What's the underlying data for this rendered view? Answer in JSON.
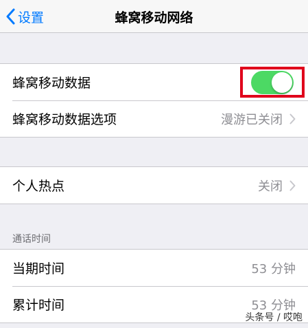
{
  "navbar": {
    "back_label": "设置",
    "title": "蜂窝移动网络"
  },
  "cellular_group": {
    "cellular_data_label": "蜂窝移动数据",
    "cellular_data_enabled": true,
    "cellular_options_label": "蜂窝移动数据选项",
    "cellular_options_value": "漫游已关闭"
  },
  "hotspot_group": {
    "label": "个人热点",
    "value": "关闭"
  },
  "call_time": {
    "header": "通话时间",
    "current_period_label": "当期时间",
    "current_period_value": "53 分钟",
    "lifetime_label": "累计时间",
    "lifetime_value": "53 分钟"
  },
  "watermark": "头条号 / 哎咆",
  "colors": {
    "accent": "#007aff",
    "toggle_on": "#4cd964",
    "highlight_box": "#e0001b",
    "background": "#efeff4"
  }
}
